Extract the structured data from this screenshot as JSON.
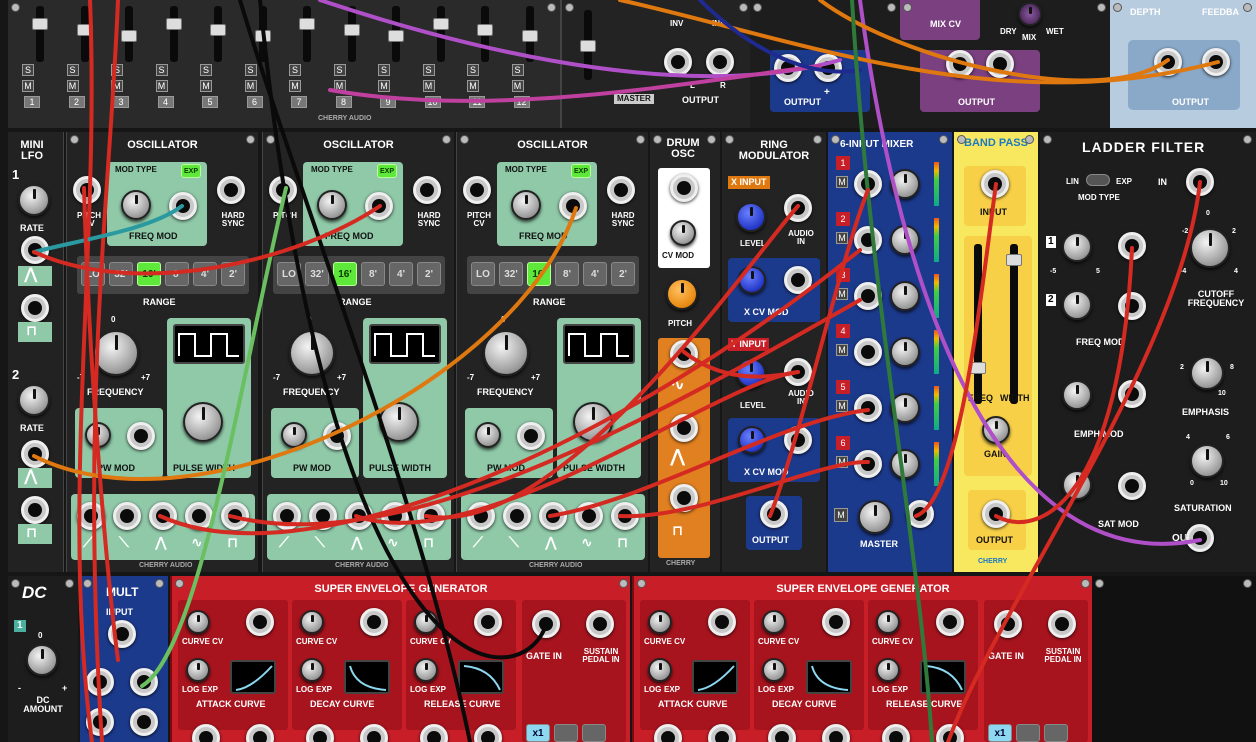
{
  "colors": {
    "cable_red": "#d42a22",
    "cable_black": "#0a0a0a",
    "cable_purple": "#b050c8",
    "cable_orange": "#e07810",
    "cable_green": "#2f7a3a",
    "cable_teal": "#2a9aa0",
    "cable_lightgreen": "#6ac060",
    "cable_darkblue": "#1e2a90",
    "cable_magenta": "#c040a0",
    "osc_green": "#8fc9a8",
    "env_red": "#c81e28",
    "mixer_blue": "#1c3a8c",
    "bandpass_yellow": "#f8e860"
  },
  "brand": {
    "cherry": "CHERRY AUDIO",
    "cherry_short": "CHERRY"
  },
  "top_row": {
    "mixer_channel_numbers": [
      "1",
      "2",
      "3",
      "4",
      "5",
      "6",
      "7",
      "8",
      "9",
      "10",
      "11",
      "12"
    ],
    "solo_label": "S",
    "mute_label": "M",
    "master_label": "MASTER",
    "inv_label": "INV",
    "output_label": "OUTPUT",
    "l_label": "L",
    "r_label": "R",
    "plus_label": "+",
    "mix_cv_label": "MIX CV",
    "dry_label": "DRY",
    "mix_label": "MIX",
    "wet_label": "WET",
    "depth_label": "DEPTH",
    "feedback_label": "FEEDBA"
  },
  "mini_lfo": {
    "title": "MINI LFO",
    "ch1": "1",
    "ch2": "2",
    "rate_label": "RATE",
    "wave_icons": [
      "triangle-icon",
      "square-icon"
    ]
  },
  "oscillators": [
    {
      "title": "OSCILLATOR",
      "mod_type": "MOD TYPE",
      "exp": "EXP",
      "pitch_cv": "PITCH CV",
      "freq_mod": "FREQ MOD",
      "hard_sync": "HARD SYNC",
      "range": "RANGE",
      "range_buttons": [
        "LO",
        "32'",
        "16'",
        "8'",
        "4'",
        "2'"
      ],
      "range_active": 2,
      "frequency": "FREQUENCY",
      "freq_min": "-7",
      "freq_max": "+7",
      "freq_zero": "0",
      "pw_mod": "PW MOD",
      "pulse_width": "PULSE WIDTH"
    },
    {
      "title": "OSCILLATOR",
      "mod_type": "MOD TYPE",
      "exp": "EXP",
      "pitch_cv": "PITCH",
      "freq_mod": "FREQ MOD",
      "hard_sync": "HARD SYNC",
      "range": "RANGE",
      "range_buttons": [
        "LO",
        "32'",
        "16'",
        "8'",
        "4'",
        "2'"
      ],
      "range_active": 2,
      "frequency": "FREQUENCY",
      "freq_min": "-7",
      "freq_max": "+7",
      "freq_zero": "0",
      "pw_mod": "PW MOD",
      "pulse_width": "PULSE WIDTH"
    },
    {
      "title": "OSCILLATOR",
      "mod_type": "MOD TYPE",
      "exp": "EXP",
      "pitch_cv": "PITCH CV",
      "freq_mod": "FREQ MOD",
      "hard_sync": "HARD SYNC",
      "range": "RANGE",
      "range_buttons": [
        "LO",
        "32'",
        "16'",
        "8'",
        "4'",
        "2'"
      ],
      "range_active": 2,
      "frequency": "FREQUENCY",
      "freq_min": "-7",
      "freq_max": "+7",
      "freq_zero": "0",
      "pw_mod": "PW MOD",
      "pulse_width": "PULSE WIDTH"
    }
  ],
  "drum_osc": {
    "title": "DRUM OSC",
    "cv_mod": "CV MOD",
    "pitch": "PITCH"
  },
  "ring_mod": {
    "title": "RING MODULATOR",
    "x_input": "X INPUT",
    "y_input": "Y INPUT",
    "level": "LEVEL",
    "audio_in": "AUDIO IN",
    "xcv_mod": "X CV MOD",
    "output": "OUTPUT"
  },
  "mixer6": {
    "title": "6-INPUT MIXER",
    "channels": [
      "1",
      "2",
      "3",
      "4",
      "5",
      "6"
    ],
    "master": "MASTER",
    "m": "M"
  },
  "band_pass": {
    "title": "BAND PASS",
    "input": "INPUT",
    "freq": "FREQ",
    "width": "WIDTH",
    "gain": "GAIN",
    "output": "OUTPUT"
  },
  "ladder": {
    "title": "LADDER FILTER",
    "lin": "LIN",
    "exp": "EXP",
    "mod_type": "MOD TYPE",
    "in": "IN",
    "cutoff": "CUTOFF FREQUENCY",
    "freq_mod": "FREQ MOD",
    "emph_mod": "EMPH MOD",
    "emphasis": "EMPHASIS",
    "sat_mod": "SAT MOD",
    "saturation": "SATURATION",
    "out": "OUT",
    "ch1": "1",
    "ch2": "2",
    "scale_neg5": "-5",
    "scale_0": "0",
    "scale_5": "5",
    "scale_neg2": "-2",
    "scale_2": "2",
    "scale_4": "4",
    "scale_neg4": "-4",
    "scale_6": "6",
    "scale_8": "8",
    "scale_10": "10"
  },
  "dc": {
    "title": "DC",
    "ch1": "1",
    "zero": "0",
    "dc_amount": "DC AMOUNT",
    "minus": "-",
    "plus": "+"
  },
  "mult": {
    "title": "MULT",
    "input": "INPUT"
  },
  "envelopes": [
    {
      "title": "SUPER ENVELOPE GENERATOR",
      "curve_cv": "CURVE CV",
      "log": "LOG",
      "exp": "EXP",
      "attack_curve": "ATTACK CURVE",
      "decay_curve": "DECAY CURVE",
      "release_curve": "RELEASE CURVE",
      "gate_in": "GATE IN",
      "sustain_pedal_in": "SUSTAIN PEDAL IN",
      "x1": "x1"
    },
    {
      "title": "SUPER ENVELOPE GENERATOR",
      "curve_cv": "CURVE CV",
      "log": "LOG",
      "exp": "EXP",
      "attack_curve": "ATTACK CURVE",
      "decay_curve": "DECAY CURVE",
      "release_curve": "RELEASE CURVE",
      "gate_in": "GATE IN",
      "sustain_pedal_in": "SUSTAIN PEDAL IN",
      "x1": "x1"
    }
  ]
}
